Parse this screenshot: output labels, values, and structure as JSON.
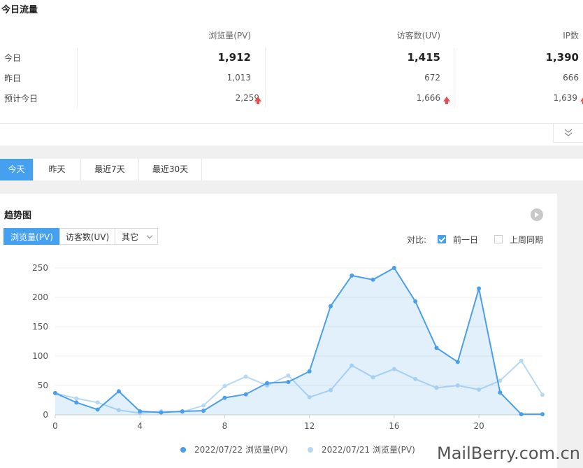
{
  "traffic": {
    "title": "今日流量",
    "columns": [
      "浏览量(PV)",
      "访客数(UV)",
      "IP数"
    ],
    "rows": [
      {
        "label": "今日",
        "values": [
          "1,912",
          "1,415",
          "1,390"
        ]
      },
      {
        "label": "昨日",
        "values": [
          "1,013",
          "672",
          "666"
        ]
      },
      {
        "label": "预计今日",
        "values": [
          "2,259",
          "1,666",
          "1,639"
        ]
      }
    ],
    "up_color": "#e94e4e"
  },
  "tabs": [
    "今天",
    "昨天",
    "最近7天",
    "最近30天"
  ],
  "trend": {
    "title": "趋势图",
    "metric_tabs": [
      "浏览量(PV)",
      "访客数(UV)",
      "其它"
    ],
    "compare_label": "对比:",
    "compare_options": [
      {
        "label": "前一日",
        "checked": true
      },
      {
        "label": "上周同期",
        "checked": false
      }
    ]
  },
  "watermark": "MailBerry.com.cn",
  "chart_data": {
    "type": "area",
    "x": [
      0,
      1,
      2,
      3,
      4,
      5,
      6,
      7,
      8,
      9,
      10,
      11,
      12,
      13,
      14,
      15,
      16,
      17,
      18,
      19,
      20,
      21,
      22,
      23
    ],
    "x_ticks": [
      0,
      4,
      8,
      12,
      16,
      20
    ],
    "y_ticks": [
      0,
      50,
      100,
      150,
      200,
      250
    ],
    "ylim": [
      0,
      250
    ],
    "xlim": [
      0,
      23
    ],
    "grid": true,
    "legend_position": "bottom",
    "series": [
      {
        "name": "2022/07/22 浏览量(PV)",
        "color": "#4a9fec",
        "fill": true,
        "values": [
          37,
          21,
          9,
          40,
          6,
          4,
          6,
          7,
          29,
          35,
          54,
          56,
          74,
          185,
          237,
          230,
          250,
          193,
          114,
          90,
          215,
          38,
          1,
          1
        ]
      },
      {
        "name": "2022/07/21 浏览量(PV)",
        "color": "#b7d8f5",
        "fill": false,
        "values": [
          37,
          28,
          21,
          8,
          3,
          6,
          5,
          16,
          49,
          65,
          50,
          67,
          30,
          42,
          84,
          64,
          78,
          61,
          46,
          50,
          43,
          58,
          92,
          34
        ]
      }
    ]
  }
}
